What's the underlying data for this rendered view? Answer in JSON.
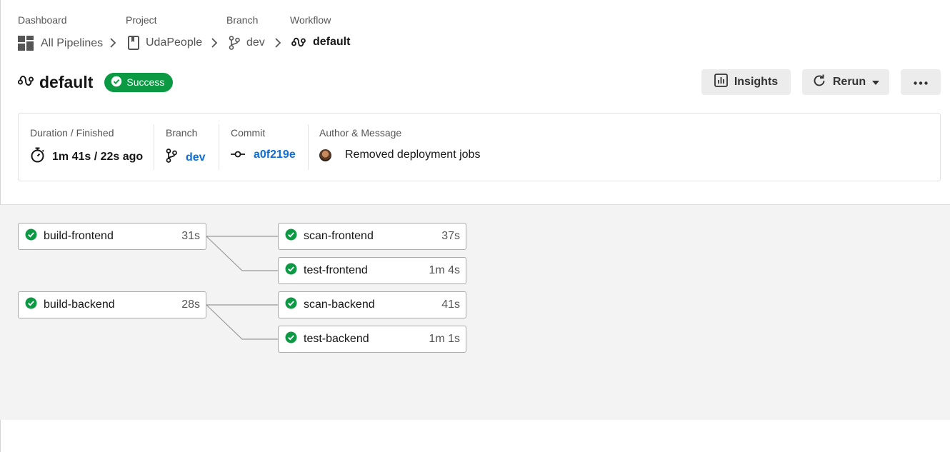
{
  "breadcrumbs": [
    {
      "label": "Dashboard",
      "value": "All Pipelines",
      "icon": "dashboard-grid-icon"
    },
    {
      "label": "Project",
      "value": "UdaPeople",
      "icon": "project-book-icon"
    },
    {
      "label": "Branch",
      "value": "dev",
      "icon": "branch-icon"
    },
    {
      "label": "Workflow",
      "value": "default",
      "icon": "workflow-icon"
    }
  ],
  "header": {
    "title": "default",
    "status": "Success",
    "insights_label": "Insights",
    "rerun_label": "Rerun"
  },
  "info": {
    "duration_label": "Duration / Finished",
    "duration_value": "1m 41s / 22s ago",
    "branch_label": "Branch",
    "branch_value": "dev",
    "commit_label": "Commit",
    "commit_value": "a0f219e",
    "author_label": "Author & Message",
    "author_message": "Removed deployment jobs"
  },
  "jobs": [
    {
      "name": "build-frontend",
      "duration": "31s",
      "status": "success"
    },
    {
      "name": "scan-frontend",
      "duration": "37s",
      "status": "success"
    },
    {
      "name": "test-frontend",
      "duration": "1m 4s",
      "status": "success"
    },
    {
      "name": "build-backend",
      "duration": "28s",
      "status": "success"
    },
    {
      "name": "scan-backend",
      "duration": "41s",
      "status": "success"
    },
    {
      "name": "test-backend",
      "duration": "1m 1s",
      "status": "success"
    }
  ],
  "colors": {
    "success": "#0b9943",
    "link": "#0f6ed4",
    "button_bg": "#ececec",
    "graph_bg": "#f3f3f3"
  }
}
